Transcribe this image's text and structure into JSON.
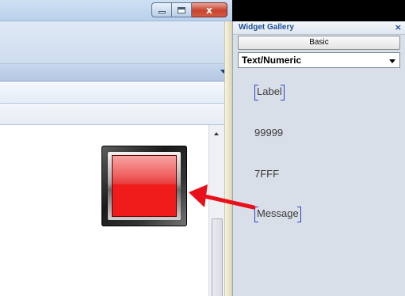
{
  "gallery": {
    "title": "Widget Gallery",
    "close_glyph": "×",
    "basic_button": "Basic",
    "category_value": "Text/Numeric",
    "items": [
      {
        "label": "Label"
      },
      {
        "label": "99999"
      },
      {
        "label": "7FFF"
      },
      {
        "label": "Message"
      }
    ]
  },
  "window_controls": {
    "close_glyph": "x"
  },
  "colors": {
    "lamp_red": "#f01c1c",
    "arrow_red": "#e8101a",
    "gallery_title": "#1d4f95",
    "selection_bracket": "#2a47c8"
  },
  "icons": [
    "minimize-icon",
    "maximize-icon",
    "close-icon",
    "chevron-down-icon",
    "scroll-up-arrow-icon",
    "pointer-arrow-icon"
  ]
}
